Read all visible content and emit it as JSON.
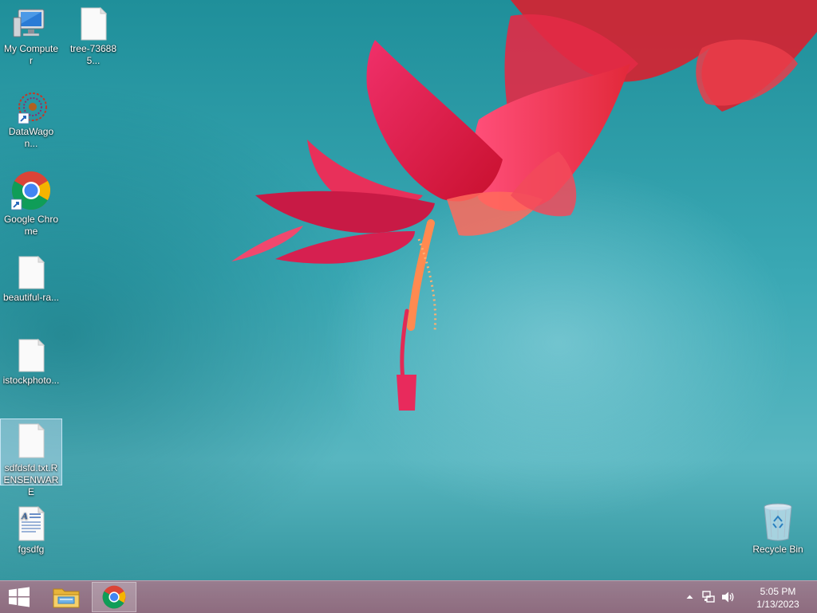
{
  "desktop": {
    "icons": [
      {
        "label": "My Computer"
      },
      {
        "label": "tree-736885..."
      },
      {
        "label": "DataWagon..."
      },
      {
        "label": "Google Chrome"
      },
      {
        "label": "beautiful-ra..."
      },
      {
        "label": "istockphoto..."
      },
      {
        "label": "sdfdsfd.txt.RENSENWARE"
      },
      {
        "label": "fgsdfg"
      },
      {
        "label": "Recycle Bin"
      }
    ]
  },
  "taskbar": {
    "start_icon": "windows-logo-icon",
    "pinned": [
      {
        "icon": "file-explorer-icon"
      },
      {
        "icon": "chrome-icon",
        "active": true
      }
    ],
    "tray": {
      "icons": [
        "show-hidden-icons-chevron",
        "network-icon",
        "volume-icon"
      ],
      "time": "5:05 PM",
      "date": "1/13/2023"
    }
  },
  "colors": {
    "wallpaper_teal": "#3aa8b4",
    "flower_red": "#e0243f",
    "taskbar": "#a8788c"
  }
}
